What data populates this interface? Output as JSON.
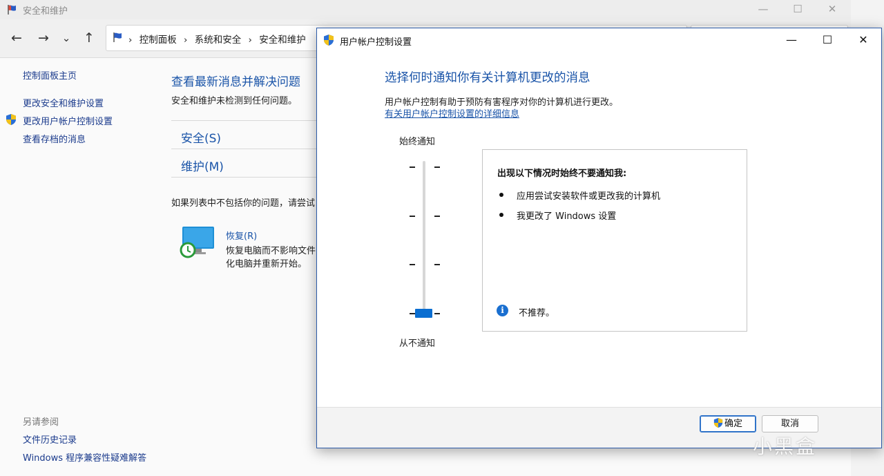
{
  "bg_window": {
    "title": "安全和维护",
    "controls": {
      "minimize": "—",
      "maximize": "☐",
      "close": "✕"
    },
    "nav": {
      "back": "←",
      "forward": "→",
      "recent": "⌄",
      "up": "↑"
    },
    "breadcrumbs": [
      "控制面板",
      "系统和安全",
      "安全和维护"
    ],
    "breadcrumb_separator": "›",
    "sidebar": {
      "home": "控制面板主页",
      "items": [
        "更改安全和维护设置",
        "更改用户帐户控制设置",
        "查看存档的消息"
      ],
      "see_also_label": "另请参阅",
      "see_also": [
        "文件历史记录",
        "Windows 程序兼容性疑难解答"
      ]
    },
    "main": {
      "heading": "查看最新消息并解决问题",
      "subtext": "安全和维护未检测到任何问题。",
      "sections": [
        "安全(S)",
        "维护(M)"
      ],
      "note": "如果列表中不包括你的问题，请尝试",
      "recovery": {
        "title": "恢复(R)",
        "desc_line1": "恢复电脑而不影响文件",
        "desc_line2": "化电脑并重新开始。"
      }
    }
  },
  "dialog": {
    "title": "用户帐户控制设置",
    "controls": {
      "minimize": "—",
      "maximize": "☐",
      "close": "✕"
    },
    "heading": "选择何时通知你有关计算机更改的消息",
    "description": "用户帐户控制有助于预防有害程序对你的计算机进行更改。",
    "info_link": "有关用户帐户控制设置的详细信息",
    "slider": {
      "top_label": "始终通知",
      "bottom_label": "从不通知",
      "levels": 4,
      "selected_level": 1
    },
    "info_panel": {
      "title": "出现以下情况时始终不要通知我:",
      "items": [
        "应用尝试安装软件或更改我的计算机",
        "我更改了 Windows 设置"
      ],
      "info_icon_char": "i",
      "note": "不推荐。"
    },
    "buttons": {
      "ok": "确定",
      "cancel": "取消"
    }
  },
  "watermark": "小黑盒",
  "colors": {
    "accent": "#1a54a8",
    "slider_thumb": "#0a6ed1",
    "dialog_border": "#2b5aa8"
  }
}
